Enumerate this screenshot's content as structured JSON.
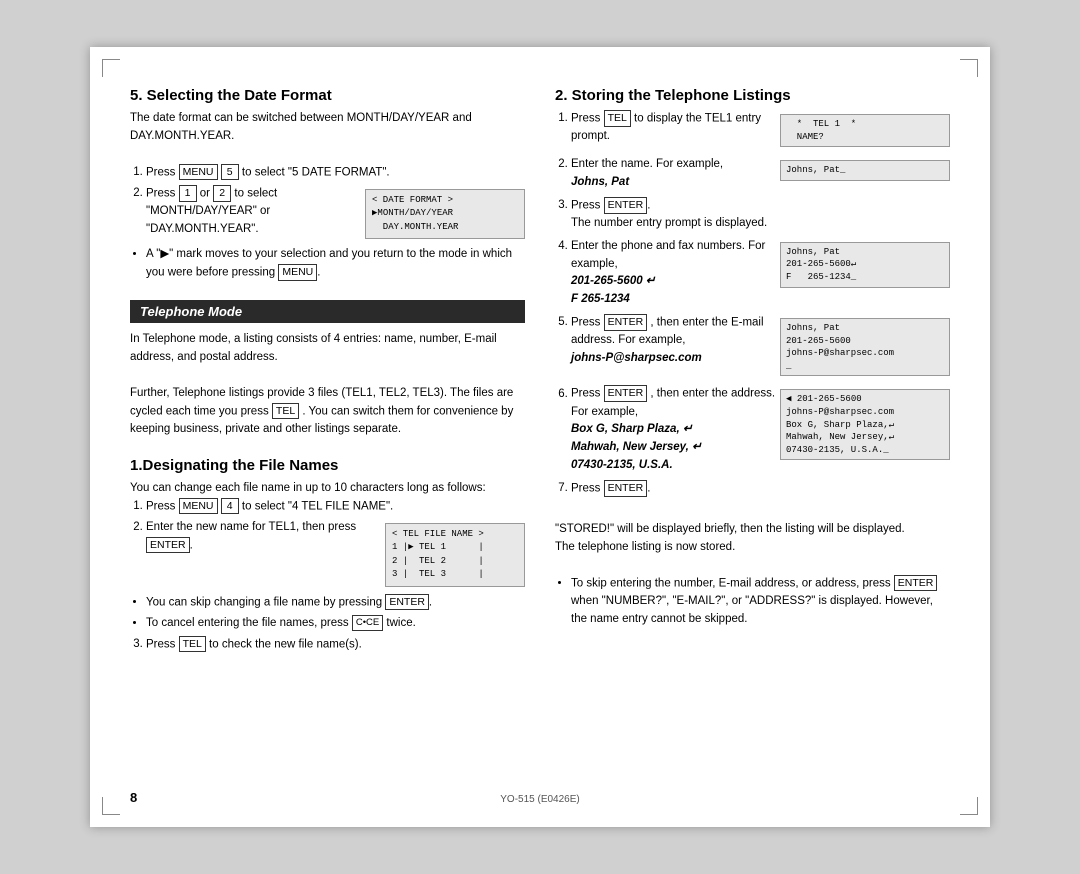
{
  "page": {
    "number": "8",
    "footer": "YO-515 (E0426E)"
  },
  "left": {
    "section1": {
      "title": "5. Selecting the Date Format",
      "intro": "The date format can be switched between MONTH/DAY/YEAR and DAY.MONTH.YEAR.",
      "steps": [
        {
          "text": "Press ",
          "key": "MENU",
          "text2": " ",
          "key2": "5",
          "text3": " to select \"5 DATE FORMAT\"."
        },
        {
          "text": "Press ",
          "key": "1",
          "text_or": " or ",
          "key2": "2",
          "text2": " to select \"MONTH/DAY/YEAR\" or \"DAY.MONTH.YEAR\"."
        }
      ],
      "bullet": "A \"▶\" mark moves to your selection and you return to the mode in which you were before pressing ",
      "bullet_key": "MENU",
      "bullet_end": ".",
      "date_format_box": "< DATE FORMAT >\n▶MONTH/DAY/YEAR\n  DAY.MONTH.YEAR"
    },
    "section2": {
      "title": "Telephone Mode",
      "para1": "In Telephone mode, a listing consists of 4 entries: name, number, E-mail address, and postal address.",
      "para2": "Further, Telephone listings provide 3 files (TEL1, TEL2, TEL3). The files are cycled each time you press ",
      "para2_key": "TEL",
      "para2_end": ". You can switch them for convenience by keeping business, private and other listings separate."
    },
    "section3": {
      "title": "1.Designating the File Names",
      "intro": "You can change each file name in up to 10 characters long as follows:",
      "steps": [
        {
          "text": "Press ",
          "key": "MENU",
          "text2": " ",
          "key2": "4",
          "text3": " to select \"4 TEL FILE NAME\"."
        },
        {
          "text": "Enter the new name for TEL1, then press ",
          "key": "ENTER",
          "text2": "."
        }
      ],
      "bullet1": "You can skip changing a file name by pressing ",
      "bullet1_key": "ENTER",
      "bullet1_end": ".",
      "bullet2": "To cancel entering the file names, press ",
      "bullet2_key": "C•CE",
      "bullet2_end": " twice.",
      "step3": "Press ",
      "step3_key": "TEL",
      "step3_end": " to check the new file name(s).",
      "tel_file_box": "< TEL FILE NAME >\n1 |▶ TEL 1      |\n2 |  TEL 2      |\n3 |  TEL 3      |"
    }
  },
  "right": {
    "section1": {
      "title": "2. Storing the Telephone Listings",
      "steps": [
        {
          "num": 1,
          "text": "Press ",
          "key": "TEL",
          "text2": " to display the TEL1 entry prompt.",
          "lcd": "  *  TEL 1  *\n  NAME?"
        },
        {
          "num": 2,
          "text": "Enter the name. For example,",
          "bold": "Johns, Pat",
          "lcd": "Johns, Pat_"
        },
        {
          "num": 3,
          "text": "Press ",
          "key": "ENTER",
          "text2": ".",
          "note": "The number entry prompt is displayed."
        },
        {
          "num": 4,
          "text": "Enter the phone and fax numbers. For example,",
          "bold1": "201-265-5600 ↵",
          "bold2": "F   265-1234",
          "lcd": "Johns, Pat\n201-265-5600↵\nF   265-1234_"
        },
        {
          "num": 5,
          "text": "Press ",
          "key": "ENTER",
          "text2": ", then enter the E-mail address. For example,",
          "bold": "johns-P@sharpsec.com",
          "lcd": "Johns, Pat\n201-265-5600\njohns-P@sharpsec.com\n_"
        },
        {
          "num": 6,
          "text": "Press ",
          "key": "ENTER",
          "text2": ", then enter the address. For example,",
          "bold1": "Box G, Sharp Plaza, ↵",
          "bold2": "Mahwah, New Jersey, ↵",
          "bold3": "07430-2135, U.S.A.",
          "lcd": "◀ 201-265-5600\njohns-P@sharpsec.com\nBox G, Sharp Plaza,↵\nMahwah, New Jersey,↵\n07430-2135, U.S.A._"
        },
        {
          "num": 7,
          "text": "Press ",
          "key": "ENTER",
          "text2": "."
        }
      ],
      "stored_note": "\"STORED!\" will be displayed briefly, then the listing will be displayed.",
      "stored_note2": "The telephone listing is now stored.",
      "bullet": "To skip entering the number, E-mail address, or address, press ",
      "bullet_key": "ENTER",
      "bullet_mid": " when \"NUMBER?\", \"E-MAIL?\", or \"ADDRESS?\" is displayed. However, the name entry cannot be skipped."
    }
  }
}
